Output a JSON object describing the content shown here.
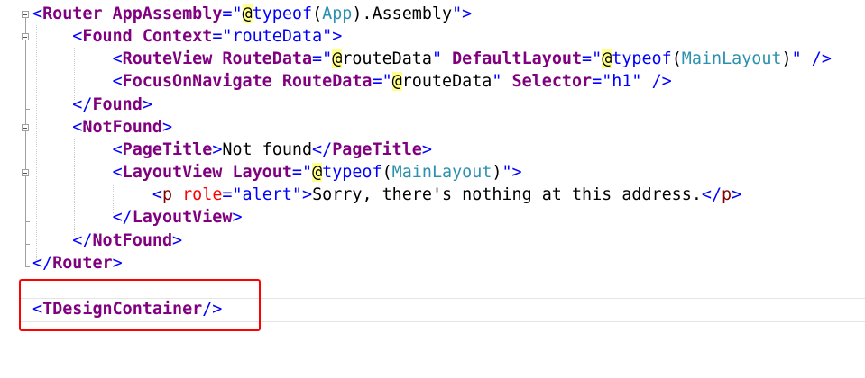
{
  "editor": {
    "lines": [
      [
        {
          "t": "<",
          "c": "delim"
        },
        {
          "t": "Router",
          "c": "tag"
        },
        {
          "t": " ",
          "c": "text"
        },
        {
          "t": "AppAssembly",
          "c": "attr"
        },
        {
          "t": "=",
          "c": "delim"
        },
        {
          "t": "\"",
          "c": "str"
        },
        {
          "t": "@",
          "c": "razor"
        },
        {
          "t": "typeof",
          "c": "kw"
        },
        {
          "t": "(",
          "c": "text"
        },
        {
          "t": "App",
          "c": "type"
        },
        {
          "t": ").Assembly",
          "c": "text"
        },
        {
          "t": "\"",
          "c": "str"
        },
        {
          "t": ">",
          "c": "delim"
        }
      ],
      [
        {
          "t": "    ",
          "c": "text"
        },
        {
          "t": "<",
          "c": "delim"
        },
        {
          "t": "Found",
          "c": "tag"
        },
        {
          "t": " ",
          "c": "text"
        },
        {
          "t": "Context",
          "c": "attr"
        },
        {
          "t": "=",
          "c": "delim"
        },
        {
          "t": "\"routeData\"",
          "c": "str"
        },
        {
          "t": ">",
          "c": "delim"
        }
      ],
      [
        {
          "t": "        ",
          "c": "text"
        },
        {
          "t": "<",
          "c": "delim"
        },
        {
          "t": "RouteView",
          "c": "tag"
        },
        {
          "t": " ",
          "c": "text"
        },
        {
          "t": "RouteData",
          "c": "attr"
        },
        {
          "t": "=",
          "c": "delim"
        },
        {
          "t": "\"",
          "c": "str"
        },
        {
          "t": "@",
          "c": "razor"
        },
        {
          "t": "routeData",
          "c": "text"
        },
        {
          "t": "\"",
          "c": "str"
        },
        {
          "t": " ",
          "c": "text"
        },
        {
          "t": "DefaultLayout",
          "c": "attr"
        },
        {
          "t": "=",
          "c": "delim"
        },
        {
          "t": "\"",
          "c": "str"
        },
        {
          "t": "@",
          "c": "razor"
        },
        {
          "t": "typeof",
          "c": "kw"
        },
        {
          "t": "(",
          "c": "text"
        },
        {
          "t": "MainLayout",
          "c": "type"
        },
        {
          "t": ")",
          "c": "text"
        },
        {
          "t": "\"",
          "c": "str"
        },
        {
          "t": " ",
          "c": "text"
        },
        {
          "t": "/>",
          "c": "delim"
        }
      ],
      [
        {
          "t": "        ",
          "c": "text"
        },
        {
          "t": "<",
          "c": "delim"
        },
        {
          "t": "FocusOnNavigate",
          "c": "tag"
        },
        {
          "t": " ",
          "c": "text"
        },
        {
          "t": "RouteData",
          "c": "attr"
        },
        {
          "t": "=",
          "c": "delim"
        },
        {
          "t": "\"",
          "c": "str"
        },
        {
          "t": "@",
          "c": "razor"
        },
        {
          "t": "routeData",
          "c": "text"
        },
        {
          "t": "\"",
          "c": "str"
        },
        {
          "t": " ",
          "c": "text"
        },
        {
          "t": "Selector",
          "c": "attr"
        },
        {
          "t": "=",
          "c": "delim"
        },
        {
          "t": "\"h1\"",
          "c": "str"
        },
        {
          "t": " ",
          "c": "text"
        },
        {
          "t": "/>",
          "c": "delim"
        }
      ],
      [
        {
          "t": "    ",
          "c": "text"
        },
        {
          "t": "</",
          "c": "delim"
        },
        {
          "t": "Found",
          "c": "tag"
        },
        {
          "t": ">",
          "c": "delim"
        }
      ],
      [
        {
          "t": "    ",
          "c": "text"
        },
        {
          "t": "<",
          "c": "delim"
        },
        {
          "t": "NotFound",
          "c": "tag"
        },
        {
          "t": ">",
          "c": "delim"
        }
      ],
      [
        {
          "t": "        ",
          "c": "text"
        },
        {
          "t": "<",
          "c": "delim"
        },
        {
          "t": "PageTitle",
          "c": "tag"
        },
        {
          "t": ">",
          "c": "delim"
        },
        {
          "t": "Not found",
          "c": "text"
        },
        {
          "t": "</",
          "c": "delim"
        },
        {
          "t": "PageTitle",
          "c": "tag"
        },
        {
          "t": ">",
          "c": "delim"
        }
      ],
      [
        {
          "t": "        ",
          "c": "text"
        },
        {
          "t": "<",
          "c": "delim"
        },
        {
          "t": "LayoutView",
          "c": "tag"
        },
        {
          "t": " ",
          "c": "text"
        },
        {
          "t": "Layout",
          "c": "attr"
        },
        {
          "t": "=",
          "c": "delim"
        },
        {
          "t": "\"",
          "c": "str"
        },
        {
          "t": "@",
          "c": "razor"
        },
        {
          "t": "typeof",
          "c": "kw"
        },
        {
          "t": "(",
          "c": "text"
        },
        {
          "t": "MainLayout",
          "c": "type"
        },
        {
          "t": ")",
          "c": "text"
        },
        {
          "t": "\"",
          "c": "str"
        },
        {
          "t": ">",
          "c": "delim"
        }
      ],
      [
        {
          "t": "            ",
          "c": "text"
        },
        {
          "t": "<",
          "c": "delim"
        },
        {
          "t": "p",
          "c": "html-tag"
        },
        {
          "t": " ",
          "c": "text"
        },
        {
          "t": "role",
          "c": "html-attr"
        },
        {
          "t": "=",
          "c": "delim"
        },
        {
          "t": "\"alert\"",
          "c": "str"
        },
        {
          "t": ">",
          "c": "delim"
        },
        {
          "t": "Sorry, there's nothing at this address.",
          "c": "text"
        },
        {
          "t": "</",
          "c": "delim"
        },
        {
          "t": "p",
          "c": "html-tag"
        },
        {
          "t": ">",
          "c": "delim"
        }
      ],
      [
        {
          "t": "        ",
          "c": "text"
        },
        {
          "t": "</",
          "c": "delim"
        },
        {
          "t": "LayoutView",
          "c": "tag"
        },
        {
          "t": ">",
          "c": "delim"
        }
      ],
      [
        {
          "t": "    ",
          "c": "text"
        },
        {
          "t": "</",
          "c": "delim"
        },
        {
          "t": "NotFound",
          "c": "tag"
        },
        {
          "t": ">",
          "c": "delim"
        }
      ],
      [
        {
          "t": "</",
          "c": "delim"
        },
        {
          "t": "Router",
          "c": "tag"
        },
        {
          "t": ">",
          "c": "delim"
        }
      ],
      [],
      [
        {
          "t": "<",
          "c": "delim"
        },
        {
          "t": "TDesignContainer",
          "c": "tag"
        },
        {
          "t": "/>",
          "c": "delim"
        }
      ]
    ],
    "colors": {
      "delimiter": "#0000ff",
      "component_tag": "#800080",
      "string": "#0000ff",
      "razor_highlight": "#ffff8c",
      "type_name": "#2b91af",
      "html_attribute": "#ff0000",
      "html_tag": "#800000",
      "annotation_box": "#ff0000"
    }
  }
}
